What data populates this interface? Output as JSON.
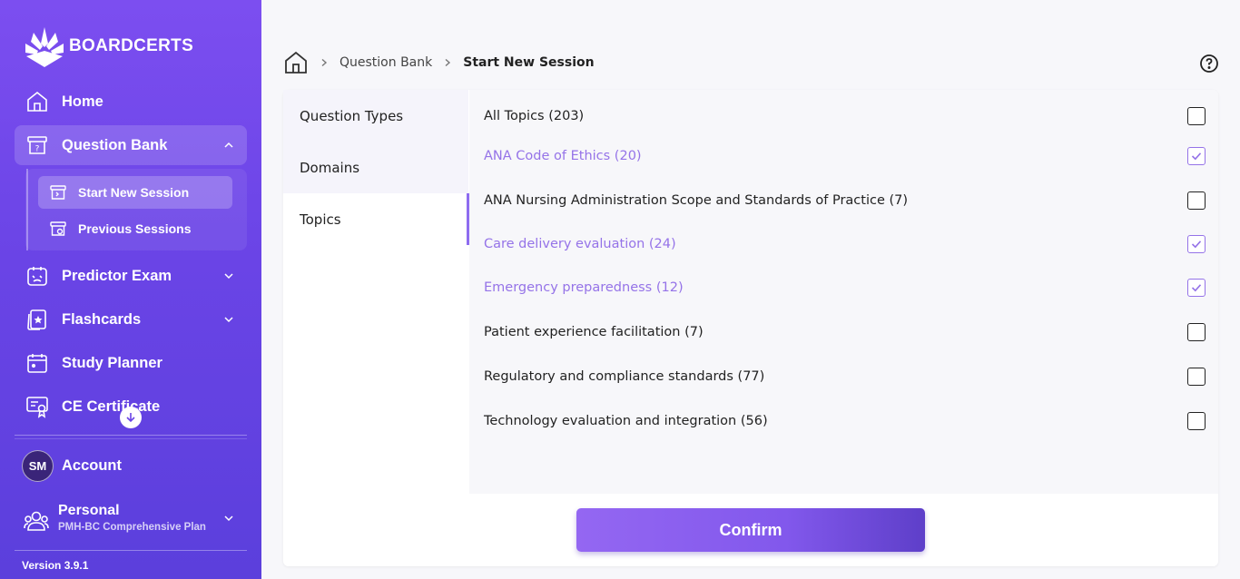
{
  "brand": {
    "name": "BOARDCERTS"
  },
  "sidebar": {
    "items": [
      {
        "label": "Home",
        "icon": "home-icon"
      },
      {
        "label": "Question Bank",
        "icon": "question-bank-icon"
      },
      {
        "label": "Predictor Exam",
        "icon": "predictor-exam-icon"
      },
      {
        "label": "Flashcards",
        "icon": "flashcards-icon"
      },
      {
        "label": "Study Planner",
        "icon": "calendar-icon"
      },
      {
        "label": "CE Certificate",
        "icon": "certificate-icon"
      }
    ],
    "sub_items": [
      {
        "label": "Start New Session",
        "icon": "start-session-icon"
      },
      {
        "label": "Previous Sessions",
        "icon": "previous-sessions-icon"
      }
    ],
    "account": {
      "initials": "SM",
      "label": "Account"
    },
    "plan": {
      "title": "Personal",
      "subtitle": "PMH-BC Comprehensive Plan"
    },
    "version": "Version 3.9.1"
  },
  "breadcrumb": {
    "link": "Question Bank",
    "current": "Start New Session"
  },
  "tabs": [
    "Question Types",
    "Domains",
    "Topics"
  ],
  "active_tab": "Topics",
  "topics": [
    {
      "label": "All Topics (203)",
      "checked": false
    },
    {
      "label": "ANA Code of Ethics (20)",
      "checked": true
    },
    {
      "label": "ANA Nursing Administration Scope and Standards of Practice (7)",
      "checked": false
    },
    {
      "label": "Care delivery evaluation (24)",
      "checked": true
    },
    {
      "label": "Emergency preparedness (12)",
      "checked": true
    },
    {
      "label": "Patient experience facilitation (7)",
      "checked": false
    },
    {
      "label": "Regulatory and compliance standards (77)",
      "checked": false
    },
    {
      "label": "Technology evaluation and integration (56)",
      "checked": false
    }
  ],
  "confirm_label": "Confirm",
  "colors": {
    "sidebar": "#6a44e6",
    "accent": "#9573e8",
    "button": "#8258ec"
  }
}
